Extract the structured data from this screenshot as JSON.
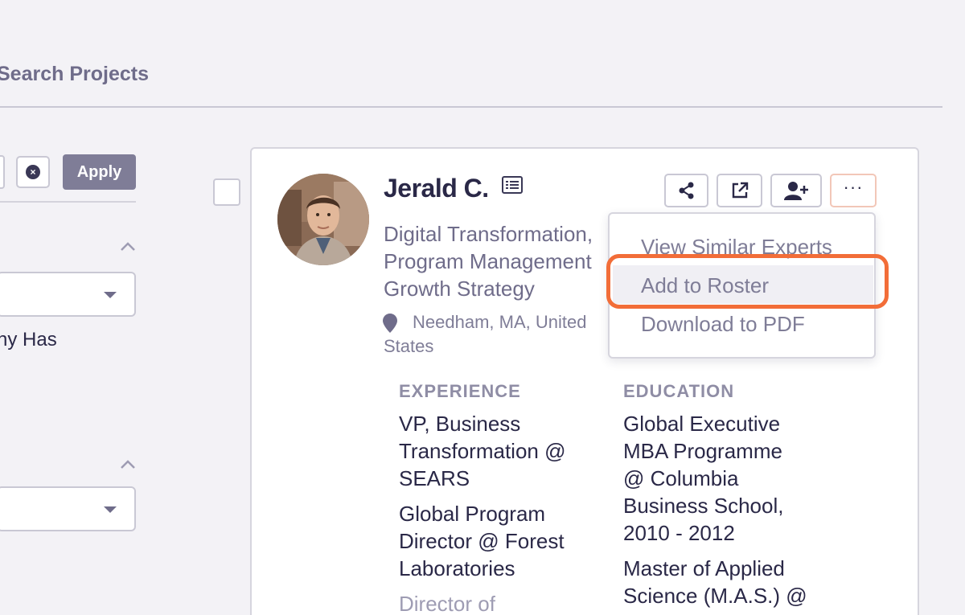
{
  "header": {
    "tab_title": "Search Projects"
  },
  "filters": {
    "apply_label": "Apply",
    "clear_symbol": "×",
    "partial_label": "ny Has"
  },
  "expert": {
    "name": "Jerald C.",
    "headline": "Digital Transformation,\nProgram Management\nGrowth Strategy",
    "location": "Needham, MA, United States"
  },
  "actions": {
    "more_label": "···"
  },
  "menu": {
    "items": [
      "View Similar Experts",
      "Add to Roster",
      "Download to PDF"
    ]
  },
  "experience": {
    "heading": "EXPERIENCE",
    "items": [
      "VP, Business\nTransformation @\nSEARS",
      "Global Program\nDirector @ Forest\nLaboratories",
      "Director of"
    ]
  },
  "education": {
    "heading": "EDUCATION",
    "items": [
      "Global Executive\nMBA Programme\n@ Columbia\nBusiness School,\n2010 - 2012",
      "Master of Applied\nScience (M.A.S.) @"
    ]
  },
  "colors": {
    "accent_focus": "#f26d38",
    "apply_bg": "#7f7d97",
    "text_primary": "#2a2847",
    "text_muted": "#6f6c8a"
  }
}
